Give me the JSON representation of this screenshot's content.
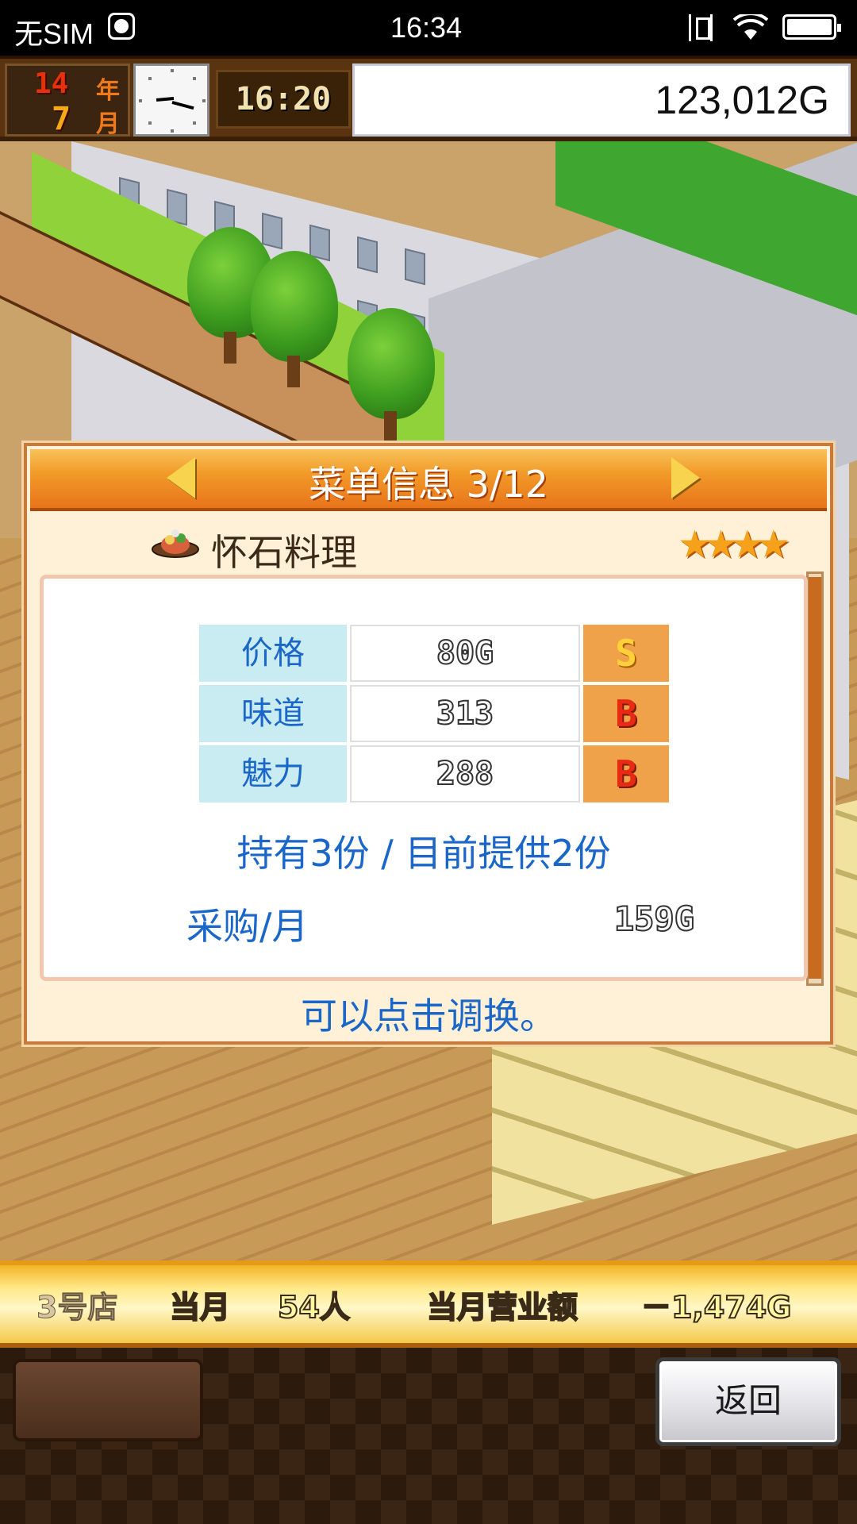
{
  "status_bar": {
    "carrier": "无SIM",
    "time": "16:34"
  },
  "top_bar": {
    "year_value": "14",
    "year_label": "年",
    "month_value": "7",
    "month_label": "月",
    "game_time": "16:20",
    "money": "123,012G"
  },
  "dialog": {
    "title": "菜单信息 3/12",
    "dish_name": "怀石料理",
    "rating_stars": "★★★★",
    "stats": [
      {
        "label": "价格",
        "value": "80G",
        "grade": "S"
      },
      {
        "label": "味道",
        "value": "313",
        "grade": "B"
      },
      {
        "label": "魅力",
        "value": "288",
        "grade": "B"
      }
    ],
    "holding_text": "持有3份 / 目前提供2份",
    "purchase_label": "采购/月",
    "purchase_value": "159G",
    "hint": "可以点击调换。"
  },
  "info_bar": {
    "shop": "3号店",
    "month_label": "当月",
    "guests": "54人",
    "revenue_label": "当月营业额",
    "revenue_value": "－1,474G"
  },
  "buttons": {
    "back": "返回"
  },
  "colors": {
    "header_orange": "#e8741a",
    "label_blue": "#1a66c9",
    "grade_bg": "#f0a24a"
  }
}
